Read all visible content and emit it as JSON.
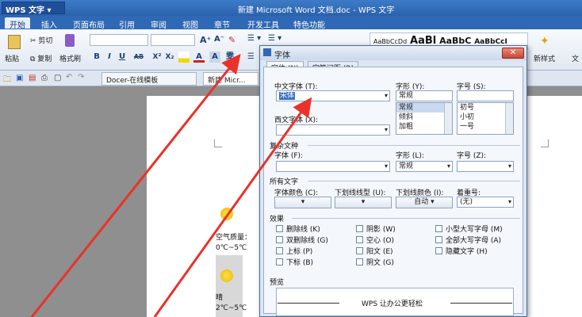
{
  "titlebar": {
    "app_button": "WPS 文字",
    "doc_title": "新建 Microsoft Word 文档.doc - WPS 文字"
  },
  "menu": [
    "开始",
    "插入",
    "页面布局",
    "引用",
    "审阅",
    "视图",
    "章节",
    "开发工具",
    "特色功能"
  ],
  "ribbon": {
    "paste": "粘贴",
    "cut": "剪切",
    "copy": "复制",
    "format_painter": "格式刷",
    "bold": "B",
    "italic": "I",
    "underline": "U",
    "strike": "AB",
    "sup": "X²",
    "sub": "X₂",
    "font_color": "A",
    "new_style": "新样式",
    "wen": "文",
    "style_samples": [
      "AaBbCcDd",
      "AaBl",
      "AaBbC",
      "AaBbCcI"
    ]
  },
  "quickbar": {
    "tabs": [
      "Docer-在线模板",
      "新建 Micr..."
    ]
  },
  "document": {
    "weather_quality": "空气质量：",
    "temp1": "0℃~5℃",
    "weather": "晴",
    "temp2": "2℃~5℃"
  },
  "dialog": {
    "title": "字体",
    "close": "✕",
    "tabs": [
      "字体 (N)",
      "字符间距 (R)"
    ],
    "cn_font_label": "中文字体 (T):",
    "cn_font_value": "宋体",
    "style_label": "字形 (Y):",
    "style_value": "常规",
    "style_options": [
      "常规",
      "倾斜",
      "加粗"
    ],
    "size_label": "字号 (S):",
    "size_options": [
      "初号",
      "小初",
      "一号"
    ],
    "west_font_label": "西文字体 (X):",
    "west_font_value": "",
    "complex_group": "复杂文种",
    "complex_font_label": "字体 (F):",
    "complex_style_label": "字形 (L):",
    "complex_style_value": "常规",
    "complex_size_label": "字号 (Z):",
    "all_text_group": "所有文字",
    "color_label": "字体颜色 (C):",
    "underline_label": "下划线线型 (U):",
    "underline_color_label": "下划线颜色 (I):",
    "underline_color_value": "自动",
    "emphasis_label": "着重号:",
    "emphasis_value": "(无)",
    "effects_group": "效果",
    "effects": [
      [
        "删除线 (K)",
        "阴影 (W)",
        "小型大写字母 (M)"
      ],
      [
        "双删除线 (G)",
        "空心 (O)",
        "全部大写字母 (A)"
      ],
      [
        "上标 (P)",
        "阳文 (E)",
        "隐藏文字 (H)"
      ],
      [
        "下标 (B)",
        "阴文 (G)",
        ""
      ]
    ],
    "preview_group": "预览",
    "preview_text": "WPS 让办公更轻松"
  },
  "colors": {
    "accent": "#2f68b5",
    "arrow": "#e8322a"
  }
}
